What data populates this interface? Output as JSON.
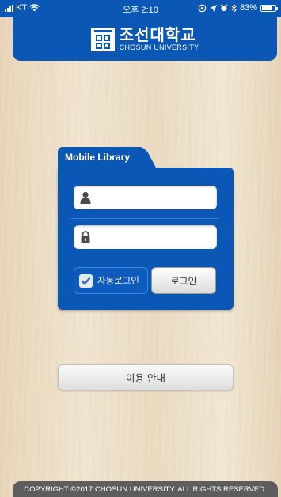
{
  "status_bar": {
    "carrier": "KT",
    "time": "오후 2:10",
    "battery_text": "83%",
    "battery_level": 0.83
  },
  "header": {
    "title_kr": "조선대학교",
    "title_en": "CHOSUN UNIVERSITY",
    "background": "#0a57b5"
  },
  "login": {
    "tab_title": "Mobile Library",
    "id_icon": "user-icon",
    "password_icon": "lock-icon",
    "id_value": "",
    "password_value": "",
    "auto_login_label": "자동로그인",
    "auto_login_checked": true,
    "login_button": "로그인"
  },
  "guide_button": "이용 안내",
  "footer": {
    "copyright": "COPYRIGHT ©2017 CHOSUN UNIVERSITY. ALL RIGHTS RESERVED."
  }
}
